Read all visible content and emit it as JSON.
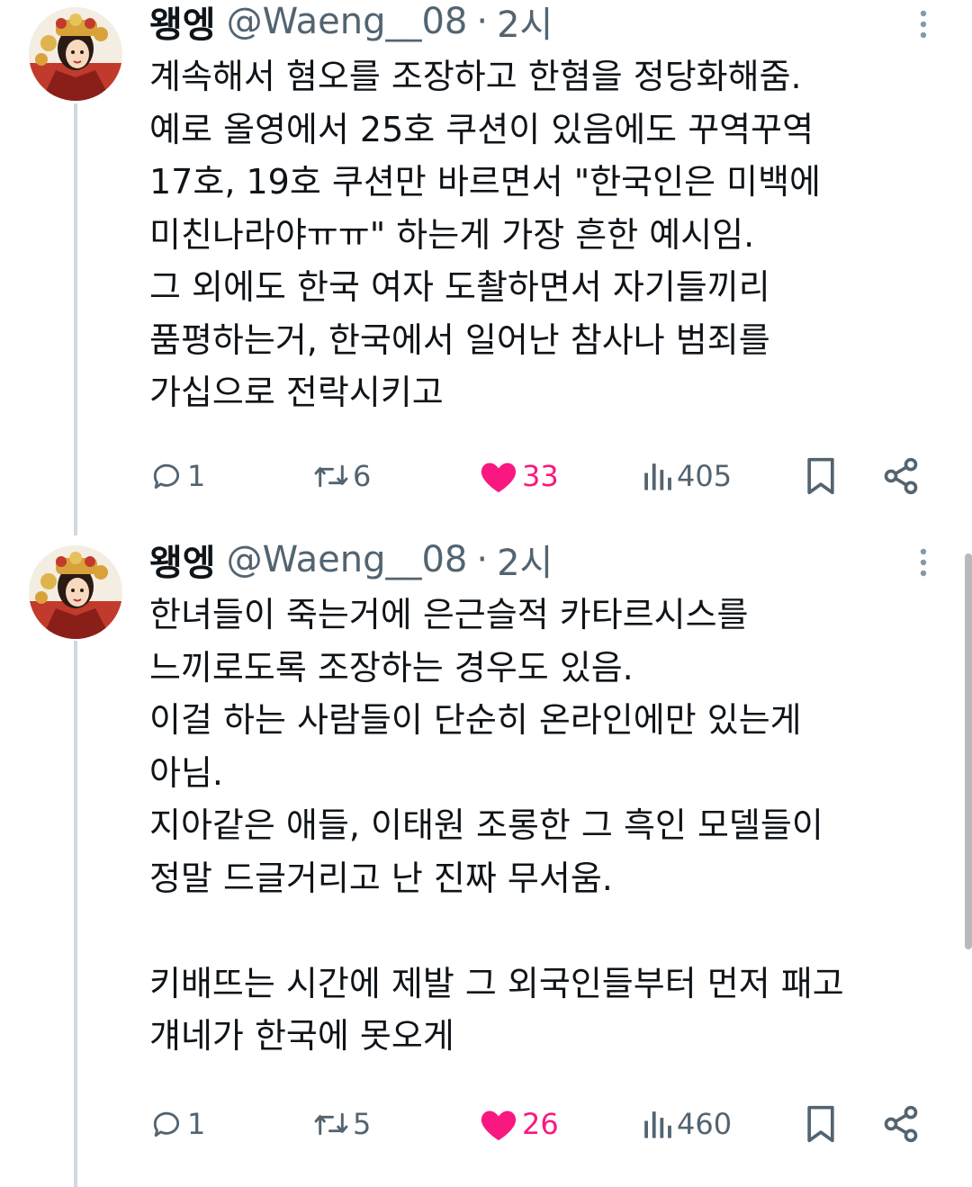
{
  "colors": {
    "text": "#0f1419",
    "muted": "#536471",
    "like": "#f91880",
    "thread_line": "#cfd9de"
  },
  "tweets": [
    {
      "display_name": "왱엥",
      "handle": "@Waeng__08",
      "separator": "·",
      "time": "2시",
      "lines": [
        "계속해서 혐오를 조장하고 한혐을 정당화해줌.",
        "예로 올영에서 25호 쿠션이 있음에도 꾸역꾸역",
        "17호, 19호 쿠션만 바르면서 \"한국인은 미백에",
        "미친나라야ㅠㅠ\" 하는게 가장 흔한 예시임.",
        "그 외에도 한국 여자 도촬하면서 자기들끼리",
        "품평하는거, 한국에서 일어난 참사나 범죄를",
        "가십으로 전락시키고"
      ],
      "replies": "1",
      "retweets": "6",
      "likes": "33",
      "views": "405",
      "icons": {
        "reply": "reply-icon",
        "retweet": "retweet-icon",
        "like": "heart-filled-icon",
        "views": "views-icon",
        "bookmark": "bookmark-icon",
        "share": "share-icon",
        "more": "more-vertical-icon"
      }
    },
    {
      "display_name": "왱엥",
      "handle": "@Waeng__08",
      "separator": "·",
      "time": "2시",
      "lines": [
        "한녀들이 죽는거에 은근슬적 카타르시스를",
        "느끼로도록 조장하는 경우도 있음.",
        "이걸 하는 사람들이 단순히 온라인에만 있는게",
        "아님.",
        "지아같은 애들, 이태원 조롱한 그 흑인 모델들이",
        "정말 드글거리고 난 진짜 무서움.",
        "",
        "키배뜨는 시간에 제발 그 외국인들부터 먼저 패고",
        "걔네가 한국에 못오게"
      ],
      "replies": "1",
      "retweets": "5",
      "likes": "26",
      "views": "460"
    }
  ]
}
